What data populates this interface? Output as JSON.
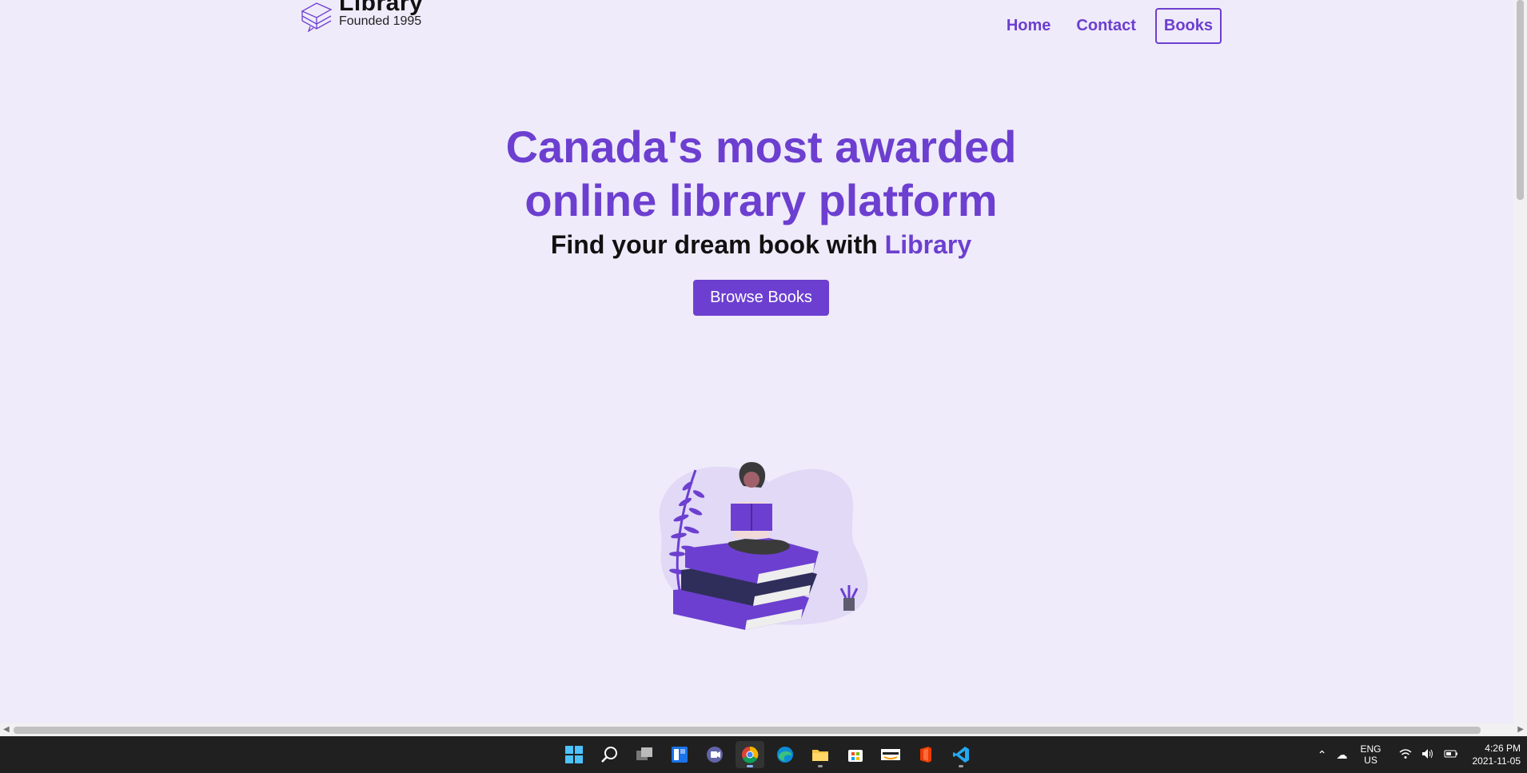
{
  "brand": {
    "name": "Library",
    "tagline": "Founded 1995",
    "logo_icon": "stacked-books-icon"
  },
  "nav": {
    "home": "Home",
    "contact": "Contact",
    "books": "Books"
  },
  "hero": {
    "title_line1": "Canada's most awarded",
    "title_line2": "online library platform",
    "subtitle_prefix": "Find your dream book with ",
    "subtitle_accent": "Library",
    "cta": "Browse Books"
  },
  "colors": {
    "accent": "#6c3fd0",
    "background": "#efebfa",
    "taskbar": "#202020"
  },
  "taskbar": {
    "apps": [
      "windows-start-icon",
      "search-icon",
      "task-view-icon",
      "widgets-icon",
      "teams-chat-icon",
      "chrome-icon",
      "edge-icon",
      "file-explorer-icon",
      "microsoft-store-icon",
      "amazon-icon",
      "office-icon",
      "vscode-icon"
    ],
    "language_line1": "ENG",
    "language_line2": "US",
    "time": "4:26 PM",
    "date": "2021-11-05"
  }
}
